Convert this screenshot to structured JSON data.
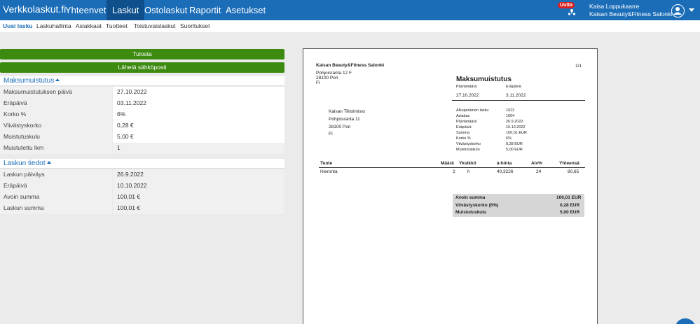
{
  "nav": {
    "brand": "Verkkolaskut.fi",
    "items": [
      "Yhteenveto",
      "Laskut",
      "Ostolaskut",
      "Raportit",
      "Asetukset"
    ],
    "active_index": 1
  },
  "header": {
    "badge": "Uutta",
    "user_name": "Kaisa Loppukaarre",
    "company": "Kaisan Beauty&Fitness Salonki"
  },
  "subnav": {
    "items": [
      "Uusi lasku",
      "Laskuhallinta",
      "Asiakkaat",
      "Tuotteet",
      "Toistuvaislaskut",
      "Suoritukset"
    ],
    "active_index": 0
  },
  "actions": {
    "print": "Tulosta",
    "send_email": "Lähetä sähköposti"
  },
  "reminder": {
    "title": "Maksumuistutus",
    "rows": [
      {
        "label": "Maksumuistutuksen päivä",
        "value": "27.10.2022",
        "editable": true
      },
      {
        "label": "Eräpäivä",
        "value": "03.11.2022",
        "editable": true
      },
      {
        "label": "Korko %",
        "value": "6%",
        "editable": true
      },
      {
        "label": "Viivästyskorko",
        "value": "0,28 €",
        "editable": true
      },
      {
        "label": "Muistutuskulu",
        "value": "5,00 €",
        "editable": true
      },
      {
        "label": "Muistutettu lkm",
        "value": "1",
        "editable": false
      }
    ]
  },
  "invoice": {
    "title": "Laskun tiedot",
    "rows": [
      {
        "label": "Laskun päiväys",
        "value": "26.9.2022"
      },
      {
        "label": "Eräpäivä",
        "value": "10.10.2022"
      },
      {
        "label": "Avoin summa",
        "value": "100,01 €"
      },
      {
        "label": "Laskun summa",
        "value": "100,01 €"
      }
    ]
  },
  "document": {
    "sender_name": "Kaisan Beauty&Fitness Salonki",
    "sender_address": [
      "Pohjoisranta 12 F",
      "28100 Pori",
      "FI"
    ],
    "page": "1/1",
    "heading": "Maksumuistutus",
    "date_label": "Päivämäärä",
    "due_label": "Eräpäivä",
    "date": "27.10.2022",
    "due": "3.11.2022",
    "recipient": [
      "Kaisan Tilitoimisto",
      "Pohjoisranta 11",
      "28100 Pori",
      "FI"
    ],
    "details": [
      {
        "label": "Alkuperäinen lasku",
        "value": "1023"
      },
      {
        "label": "Asiakas",
        "value": "1004"
      },
      {
        "label": "Päivämäärä",
        "value": "26.9.2022"
      },
      {
        "label": "Eräpäivä",
        "value": "10.10.2022"
      },
      {
        "label": "Summa",
        "value": "100,01 EUR"
      },
      {
        "label": "Korko %",
        "value": "6%"
      },
      {
        "label": "Viivästyskorko",
        "value": "0,28 EUR"
      },
      {
        "label": "Muistutuskulu",
        "value": "5,00 EUR"
      }
    ],
    "table_headers": [
      "Tuote",
      "Määrä",
      "Yksikkö",
      "à-hinta",
      "Alv%",
      "Yhteensä"
    ],
    "table_rows": [
      [
        "Hieronta",
        "2",
        "h",
        "40,3226",
        "24",
        "80,65"
      ]
    ],
    "totals": [
      {
        "label": "Avoin summa",
        "value": "100,01 EUR"
      },
      {
        "label": "Viivästyskorko (6%)",
        "value": "0,28 EUR"
      },
      {
        "label": "Muistutuskulu",
        "value": "5,00 EUR"
      }
    ]
  }
}
